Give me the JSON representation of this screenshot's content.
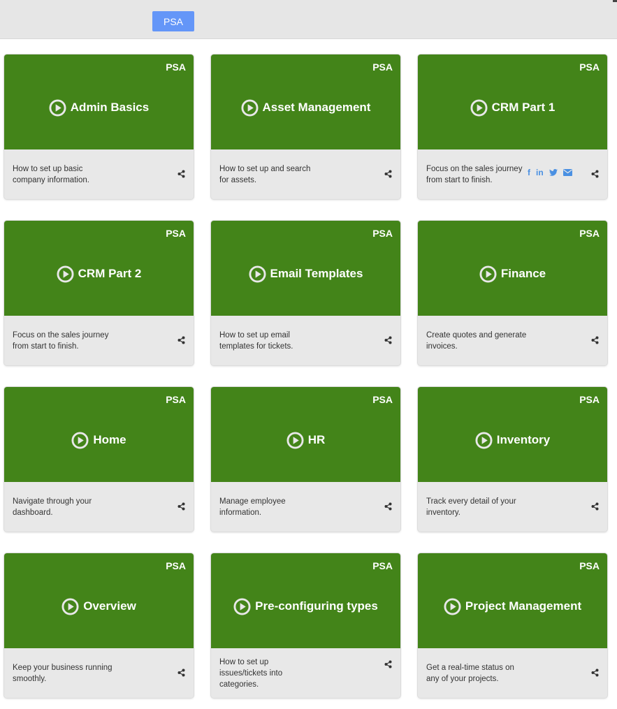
{
  "toolbar": {
    "filter_label": "PSA",
    "active_color": "#6496f8"
  },
  "theme": {
    "card_color": "#438419",
    "footer_color": "#e8e8e8"
  },
  "cards": [
    {
      "tag": "PSA",
      "title": "Admin Basics",
      "description": "How to set up basic company information."
    },
    {
      "tag": "PSA",
      "title": "Asset Management",
      "description": "How to set up and search for assets."
    },
    {
      "tag": "PSA",
      "title": "CRM Part 1",
      "description": "Focus on the sales journey from start to finish.",
      "social": {
        "facebook": "f",
        "linkedin": "in",
        "twitter": "twitter-icon",
        "email": "email-icon"
      }
    },
    {
      "tag": "PSA",
      "title": "CRM Part 2",
      "description": "Focus on the sales journey from start to finish."
    },
    {
      "tag": "PSA",
      "title": "Email Templates",
      "description": "How to set up email templates for tickets."
    },
    {
      "tag": "PSA",
      "title": "Finance",
      "description": "Create quotes and generate invoices."
    },
    {
      "tag": "PSA",
      "title": "Home",
      "description": "Navigate through your dashboard."
    },
    {
      "tag": "PSA",
      "title": "HR",
      "description": "Manage employee information."
    },
    {
      "tag": "PSA",
      "title": "Inventory",
      "description": "Track every detail of your inventory."
    },
    {
      "tag": "PSA",
      "title": "Overview",
      "description": "Keep your business running smoothly."
    },
    {
      "tag": "PSA",
      "title": "Pre-configuring types",
      "description": "How to set up issues/tickets into categories."
    },
    {
      "tag": "PSA",
      "title": "Project Management",
      "description": "Get a real-time status on any of your projects."
    }
  ]
}
